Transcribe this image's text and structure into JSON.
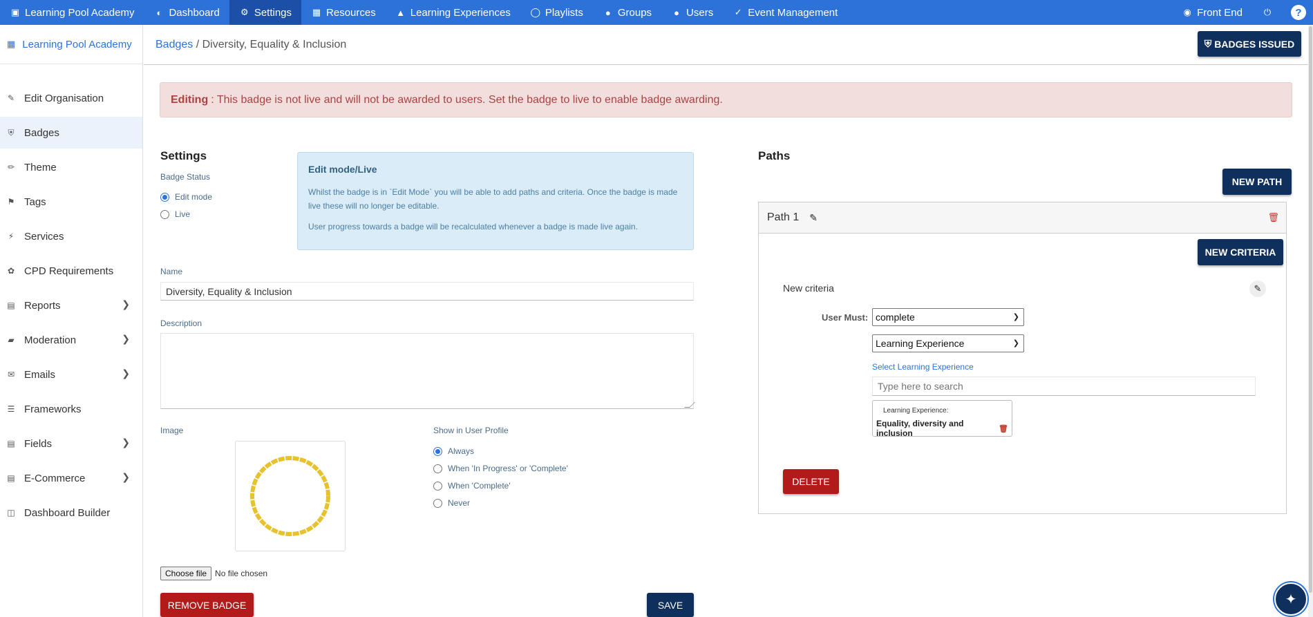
{
  "topnav": {
    "items": [
      {
        "label": "Learning Pool Academy",
        "icon": "sitemap-icon"
      },
      {
        "label": "Dashboard",
        "icon": "gauge-icon"
      },
      {
        "label": "Settings",
        "icon": "gear-icon"
      },
      {
        "label": "Resources",
        "icon": "file-icon"
      },
      {
        "label": "Learning Experiences",
        "icon": "graduation-cap-icon"
      },
      {
        "label": "Playlists",
        "icon": "lightbulb-icon"
      },
      {
        "label": "Groups",
        "icon": "users-icon"
      },
      {
        "label": "Users",
        "icon": "user-icon"
      },
      {
        "label": "Event Management",
        "icon": "event-icon"
      }
    ],
    "front_end": "Front End",
    "help": "?"
  },
  "sidebar": {
    "org": "Learning Pool Academy",
    "items": [
      {
        "label": "Edit Organisation",
        "icon": "pencil-icon",
        "chevron": false
      },
      {
        "label": "Badges",
        "icon": "shield-icon",
        "chevron": false
      },
      {
        "label": "Theme",
        "icon": "brush-icon",
        "chevron": false
      },
      {
        "label": "Tags",
        "icon": "tags-icon",
        "chevron": false
      },
      {
        "label": "Services",
        "icon": "plug-icon",
        "chevron": false
      },
      {
        "label": "CPD Requirements",
        "icon": "seedling-icon",
        "chevron": false
      },
      {
        "label": "Reports",
        "icon": "bar-chart-icon",
        "chevron": true
      },
      {
        "label": "Moderation",
        "icon": "eraser-icon",
        "chevron": true
      },
      {
        "label": "Emails",
        "icon": "envelope-icon",
        "chevron": true
      },
      {
        "label": "Frameworks",
        "icon": "list-icon",
        "chevron": false
      },
      {
        "label": "Fields",
        "icon": "form-icon",
        "chevron": true
      },
      {
        "label": "E-Commerce",
        "icon": "cart-icon",
        "chevron": true
      },
      {
        "label": "Dashboard Builder",
        "icon": "columns-icon",
        "chevron": false
      }
    ]
  },
  "header": {
    "breadcrumb_link": "Badges",
    "breadcrumb_sep": " / ",
    "breadcrumb_current": "Diversity, Equality & Inclusion",
    "badges_issued": "BADGES ISSUED"
  },
  "alert": {
    "title": "Editing",
    "message": ": This badge is not live and will not be awarded to users. Set the badge to live to enable badge awarding."
  },
  "settings": {
    "title": "Settings",
    "status_label": "Badge Status",
    "status_options": [
      "Edit mode",
      "Live"
    ],
    "status_selected": "Edit mode",
    "info_title": "Edit mode/Live",
    "info_p1": "Whilst the badge is in `Edit Mode` you will be able to add paths and criteria. Once the badge is made live these will no longer be editable.",
    "info_p2": "User progress towards a badge will be recalculated whenever a badge is made live again.",
    "name_label": "Name",
    "name_value": "Diversity, Equality & Inclusion",
    "description_label": "Description",
    "description_value": "",
    "image_label": "Image",
    "profile_label": "Show in User Profile",
    "profile_options": [
      "Always",
      "When 'In Progress' or 'Complete'",
      "When 'Complete'",
      "Never"
    ],
    "profile_selected": "Always",
    "choose_file": "Choose file",
    "no_file": "No file chosen",
    "remove_badge": "REMOVE BADGE",
    "save": "SAVE",
    "badge_color": "#e8c22e"
  },
  "paths": {
    "title": "Paths",
    "new_path": "NEW PATH",
    "path_name": "Path 1",
    "new_criteria": "NEW CRITERIA",
    "criteria_name": "New criteria",
    "user_must_label": "User Must:",
    "action_select": "complete",
    "type_select": "Learning Experience",
    "select_label": "Select Learning Experience",
    "search_placeholder": "Type here to search",
    "selected_caption": "Learning Experience:",
    "selected_value": "Equality, diversity and inclusion",
    "delete": "DELETE"
  },
  "colors": {
    "nav_bg": "#2d72d9",
    "navy": "#0f2f5c",
    "danger": "#b31b1b",
    "alert_bg": "#f3dede"
  }
}
